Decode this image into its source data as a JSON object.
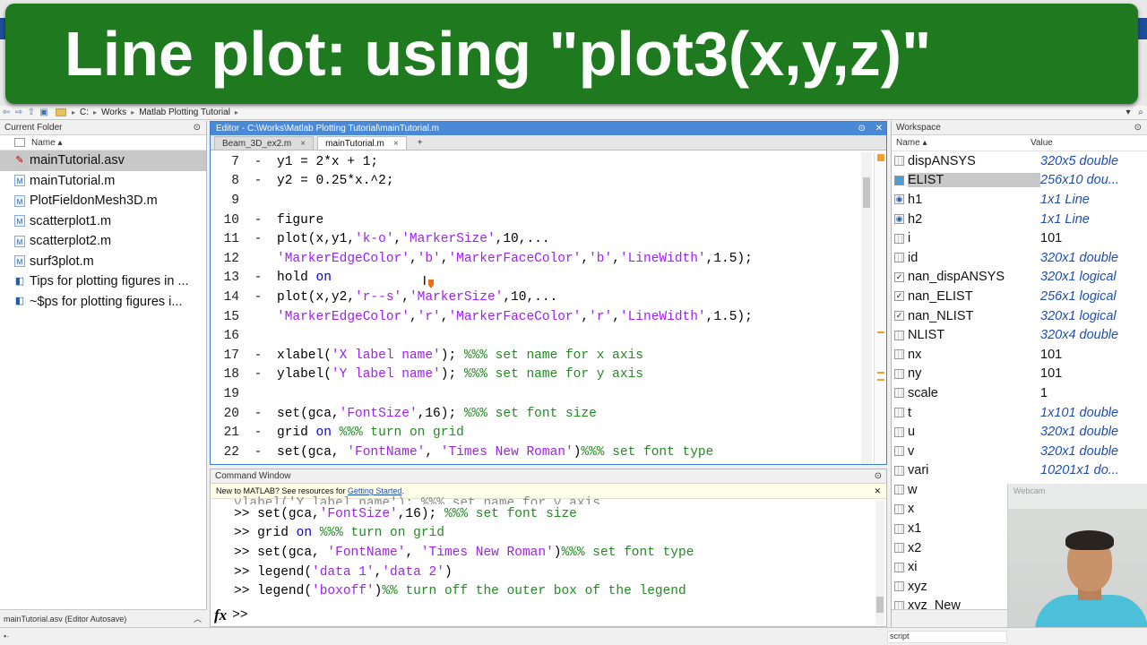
{
  "banner": {
    "title": "Line plot: using \"plot3(x,y,z)\""
  },
  "addressbar": {
    "crumbs": [
      "C:",
      "Works",
      "Matlab Plotting Tutorial"
    ]
  },
  "current_folder": {
    "title": "Current Folder",
    "column": "Name ▴",
    "files": [
      {
        "name": "mainTutorial.asv",
        "type": "asv"
      },
      {
        "name": "mainTutorial.m",
        "type": "m"
      },
      {
        "name": "PlotFieldonMesh3D.m",
        "type": "m"
      },
      {
        "name": "scatterplot1.m",
        "type": "m"
      },
      {
        "name": "scatterplot2.m",
        "type": "m"
      },
      {
        "name": "surf3plot.m",
        "type": "m"
      },
      {
        "name": "Tips for plotting figures in ...",
        "type": "mlx"
      },
      {
        "name": "~$ps for plotting figures i...",
        "type": "mlx"
      }
    ],
    "status": "mainTutorial.asv (Editor Autosave)"
  },
  "editor": {
    "title": "Editor - C:\\Works\\Matlab Plotting Tutorial\\mainTutorial.m",
    "tabs": [
      {
        "label": "Beam_3D_ex2.m",
        "close": "×"
      },
      {
        "label": "mainTutorial.m",
        "close": "×"
      }
    ],
    "add_tab": "+",
    "lines": [
      {
        "n": "7",
        "dash": "-",
        "parts": [
          [
            "t",
            "y1 = 2*x + 1;"
          ]
        ]
      },
      {
        "n": "8",
        "dash": "-",
        "parts": [
          [
            "t",
            "y2 = 0.25*x.^2;"
          ]
        ]
      },
      {
        "n": "9",
        "dash": "",
        "parts": []
      },
      {
        "n": "10",
        "dash": "-",
        "parts": [
          [
            "t",
            "figure"
          ]
        ]
      },
      {
        "n": "11",
        "dash": "-",
        "parts": [
          [
            "t",
            "plot(x,y1,"
          ],
          [
            "s",
            "'k-o'"
          ],
          [
            "t",
            ","
          ],
          [
            "s",
            "'MarkerSize'"
          ],
          [
            "t",
            ",10,..."
          ]
        ]
      },
      {
        "n": "12",
        "dash": "",
        "parts": [
          [
            "s",
            "'MarkerEdgeColor'"
          ],
          [
            "t",
            ","
          ],
          [
            "s",
            "'b'"
          ],
          [
            "t",
            ","
          ],
          [
            "s",
            "'MarkerFaceColor'"
          ],
          [
            "t",
            ","
          ],
          [
            "s",
            "'b'"
          ],
          [
            "t",
            ","
          ],
          [
            "s",
            "'LineWidth'"
          ],
          [
            "t",
            ",1.5);"
          ]
        ]
      },
      {
        "n": "13",
        "dash": "-",
        "parts": [
          [
            "t",
            "hold "
          ],
          [
            "k",
            "on"
          ]
        ]
      },
      {
        "n": "14",
        "dash": "-",
        "parts": [
          [
            "t",
            "plot(x,y2,"
          ],
          [
            "s",
            "'r--s'"
          ],
          [
            "t",
            ","
          ],
          [
            "s",
            "'MarkerSize'"
          ],
          [
            "t",
            ",10,..."
          ]
        ]
      },
      {
        "n": "15",
        "dash": "",
        "parts": [
          [
            "s",
            "'MarkerEdgeColor'"
          ],
          [
            "t",
            ","
          ],
          [
            "s",
            "'r'"
          ],
          [
            "t",
            ","
          ],
          [
            "s",
            "'MarkerFaceColor'"
          ],
          [
            "t",
            ","
          ],
          [
            "s",
            "'r'"
          ],
          [
            "t",
            ","
          ],
          [
            "s",
            "'LineWidth'"
          ],
          [
            "t",
            ",1.5);"
          ]
        ]
      },
      {
        "n": "16",
        "dash": "",
        "parts": []
      },
      {
        "n": "17",
        "dash": "-",
        "parts": [
          [
            "t",
            "xlabel("
          ],
          [
            "s",
            "'X label name'"
          ],
          [
            "t",
            "); "
          ],
          [
            "c",
            "%%% set name for x axis"
          ]
        ]
      },
      {
        "n": "18",
        "dash": "-",
        "parts": [
          [
            "t",
            "ylabel("
          ],
          [
            "s",
            "'Y label name'"
          ],
          [
            "t",
            "); "
          ],
          [
            "c",
            "%%% set name for y axis"
          ]
        ]
      },
      {
        "n": "19",
        "dash": "",
        "parts": []
      },
      {
        "n": "20",
        "dash": "-",
        "parts": [
          [
            "t",
            "set(gca,"
          ],
          [
            "s",
            "'FontSize'"
          ],
          [
            "t",
            ",16); "
          ],
          [
            "c",
            "%%% set font size"
          ]
        ]
      },
      {
        "n": "21",
        "dash": "-",
        "parts": [
          [
            "t",
            "grid "
          ],
          [
            "k",
            "on"
          ],
          [
            "t",
            " "
          ],
          [
            "c",
            "%%% turn on grid"
          ]
        ]
      },
      {
        "n": "22",
        "dash": "-",
        "parts": [
          [
            "t",
            "set(gca, "
          ],
          [
            "s",
            "'FontName'"
          ],
          [
            "t",
            ", "
          ],
          [
            "s",
            "'Times New Roman'"
          ],
          [
            "t",
            ")"
          ],
          [
            "c",
            "%%% set font type"
          ]
        ]
      }
    ]
  },
  "command_window": {
    "title": "Command Window",
    "notice_prefix": "New to MATLAB? See resources for ",
    "notice_link": "Getting Started",
    "notice_suffix": ".",
    "cut_line": "ylabel('Y label name'); %%% set name for y axis",
    "lines": [
      {
        "parts": [
          [
            "t",
            ">> set(gca,"
          ],
          [
            "s",
            "'FontSize'"
          ],
          [
            "t",
            ",16); "
          ],
          [
            "c",
            "%%% set font size"
          ]
        ]
      },
      {
        "parts": [
          [
            "t",
            ">> grid "
          ],
          [
            "k",
            "on"
          ],
          [
            "t",
            " "
          ],
          [
            "c",
            "%%% turn on grid"
          ]
        ]
      },
      {
        "parts": [
          [
            "t",
            ">> set(gca, "
          ],
          [
            "s",
            "'FontName'"
          ],
          [
            "t",
            ", "
          ],
          [
            "s",
            "'Times New Roman'"
          ],
          [
            "t",
            ")"
          ],
          [
            "c",
            "%%% set font type"
          ]
        ]
      },
      {
        "parts": [
          [
            "t",
            ">> legend("
          ],
          [
            "s",
            "'data 1'"
          ],
          [
            "t",
            ","
          ],
          [
            "s",
            "'data 2'"
          ],
          [
            "t",
            ")"
          ]
        ]
      },
      {
        "parts": [
          [
            "t",
            ">> legend("
          ],
          [
            "s",
            "'boxoff'"
          ],
          [
            "t",
            ")"
          ],
          [
            "c",
            "%% turn off the outer box of the legend"
          ]
        ]
      }
    ],
    "prompt": ">>",
    "fx": "fx"
  },
  "workspace": {
    "title": "Workspace",
    "col_name": "Name ▴",
    "col_value": "Value",
    "vars": [
      {
        "name": "dispANSYS",
        "value": "320x5 double",
        "icon": "grid",
        "style": "italic"
      },
      {
        "name": "ELIST",
        "value": "256x10 dou...",
        "icon": "blue",
        "style": "italic",
        "selected": true
      },
      {
        "name": "h1",
        "value": "1x1 Line",
        "icon": "line",
        "style": "italic"
      },
      {
        "name": "h2",
        "value": "1x1 Line",
        "icon": "line",
        "style": "italic"
      },
      {
        "name": "i",
        "value": "101",
        "icon": "grid",
        "style": "plain"
      },
      {
        "name": "id",
        "value": "320x1 double",
        "icon": "grid",
        "style": "italic"
      },
      {
        "name": "nan_dispANSYS",
        "value": "320x1 logical",
        "icon": "check",
        "style": "italic"
      },
      {
        "name": "nan_ELIST",
        "value": "256x1 logical",
        "icon": "check",
        "style": "italic"
      },
      {
        "name": "nan_NLIST",
        "value": "320x1 logical",
        "icon": "check",
        "style": "italic"
      },
      {
        "name": "NLIST",
        "value": "320x4 double",
        "icon": "grid",
        "style": "italic"
      },
      {
        "name": "nx",
        "value": "101",
        "icon": "grid",
        "style": "plain"
      },
      {
        "name": "ny",
        "value": "101",
        "icon": "grid",
        "style": "plain"
      },
      {
        "name": "scale",
        "value": "1",
        "icon": "grid",
        "style": "plain"
      },
      {
        "name": "t",
        "value": "1x101 double",
        "icon": "grid",
        "style": "italic"
      },
      {
        "name": "u",
        "value": "320x1 double",
        "icon": "grid",
        "style": "italic"
      },
      {
        "name": "v",
        "value": "320x1 double",
        "icon": "grid",
        "style": "italic"
      },
      {
        "name": "vari",
        "value": "10201x1 do...",
        "icon": "grid",
        "style": "italic"
      },
      {
        "name": "w",
        "value": "",
        "icon": "grid",
        "style": "plain"
      },
      {
        "name": "x",
        "value": "",
        "icon": "grid",
        "style": "plain"
      },
      {
        "name": "x1",
        "value": "",
        "icon": "grid",
        "style": "plain"
      },
      {
        "name": "x2",
        "value": "",
        "icon": "grid",
        "style": "plain"
      },
      {
        "name": "xi",
        "value": "",
        "icon": "grid",
        "style": "plain"
      },
      {
        "name": "xyz",
        "value": "",
        "icon": "grid",
        "style": "plain"
      },
      {
        "name": "xyz_New",
        "value": "",
        "icon": "grid",
        "style": "plain"
      }
    ]
  },
  "webcam": {
    "label": "Webcam"
  },
  "statusbar": {
    "script": "script"
  }
}
